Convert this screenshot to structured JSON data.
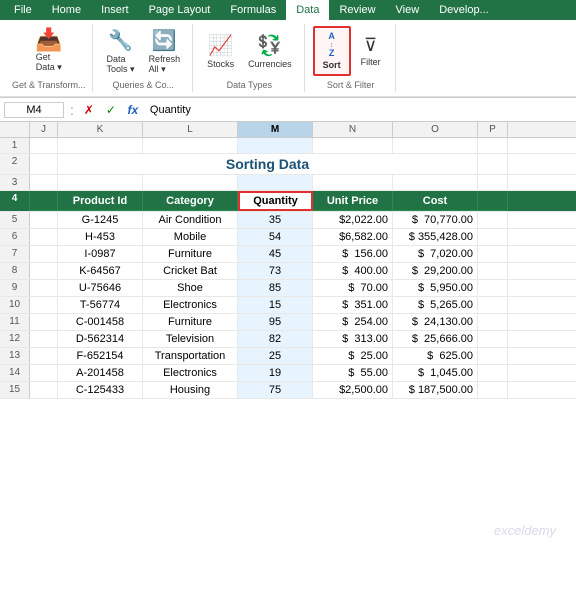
{
  "tabs": [
    "File",
    "Home",
    "Insert",
    "Page Layout",
    "Formulas",
    "Data",
    "Review",
    "View",
    "Develop..."
  ],
  "active_tab": "Data",
  "ribbon": {
    "groups": [
      {
        "label": "Get & Transform...",
        "buttons": [
          {
            "id": "get-data",
            "icon": "📥",
            "label": "Get\nData ▾"
          },
          {
            "id": "from-sheet",
            "icon": "📋",
            "label": ""
          },
          {
            "id": "recent",
            "icon": "🕐",
            "label": ""
          }
        ]
      },
      {
        "label": "Queries & Co...",
        "buttons": [
          {
            "id": "data-tools",
            "icon": "🔧",
            "label": "Data\nTools ▾"
          }
        ]
      },
      {
        "label": "Data Types",
        "buttons": [
          {
            "id": "stocks",
            "icon": "📈",
            "label": "Stocks"
          },
          {
            "id": "currencies",
            "icon": "💱",
            "label": "Currencies"
          }
        ]
      },
      {
        "label": "Sort & Filter",
        "buttons": [
          {
            "id": "refresh-all",
            "icon": "🔄",
            "label": "Refresh\nAll ▾"
          },
          {
            "id": "sort-az",
            "label": "Sort",
            "highlighted": true
          },
          {
            "id": "filter",
            "icon": "▽",
            "label": "Filter"
          }
        ]
      }
    ],
    "cell_ref": "M4",
    "formula": "Quantity"
  },
  "title": "Sorting Data",
  "columns": {
    "headers": [
      "J",
      "K",
      "L",
      "M",
      "N",
      "O",
      "P"
    ]
  },
  "rows": [
    {
      "row": 1,
      "cells": [
        "",
        "",
        "",
        "",
        "",
        "",
        ""
      ]
    },
    {
      "row": 2,
      "cells": [
        "",
        "",
        "",
        "Sorting Data",
        "",
        "",
        ""
      ],
      "type": "title"
    },
    {
      "row": 3,
      "cells": [
        "",
        "",
        "",
        "",
        "",
        "",
        ""
      ],
      "type": "empty"
    },
    {
      "row": 4,
      "cells": [
        "",
        "Product Id",
        "Category",
        "Quantity",
        "Unit Price",
        "Cost",
        ""
      ],
      "type": "header"
    },
    {
      "row": 5,
      "cells": [
        "",
        "G-1245",
        "Air Condition",
        "35",
        "$2,022.00",
        "$ 70,770.00",
        ""
      ]
    },
    {
      "row": 6,
      "cells": [
        "",
        "H-453",
        "Mobile",
        "54",
        "$6,582.00",
        "$ 355,428.00",
        ""
      ]
    },
    {
      "row": 7,
      "cells": [
        "",
        "I-0987",
        "Furniture",
        "45",
        "$  156.00",
        "$   7,020.00",
        ""
      ]
    },
    {
      "row": 8,
      "cells": [
        "",
        "K-64567",
        "Cricket Bat",
        "73",
        "$  400.00",
        "$  29,200.00",
        ""
      ]
    },
    {
      "row": 9,
      "cells": [
        "",
        "U-75646",
        "Shoe",
        "85",
        "$   70.00",
        "$   5,950.00",
        ""
      ]
    },
    {
      "row": 10,
      "cells": [
        "",
        "T-56774",
        "Electronics",
        "15",
        "$  351.00",
        "$   5,265.00",
        ""
      ]
    },
    {
      "row": 11,
      "cells": [
        "",
        "C-001458",
        "Furniture",
        "95",
        "$  254.00",
        "$  24,130.00",
        ""
      ]
    },
    {
      "row": 12,
      "cells": [
        "",
        "D-562314",
        "Television",
        "82",
        "$  313.00",
        "$  25,666.00",
        ""
      ]
    },
    {
      "row": 13,
      "cells": [
        "",
        "F-652154",
        "Transportation",
        "25",
        "$   25.00",
        "$     625.00",
        ""
      ]
    },
    {
      "row": 14,
      "cells": [
        "",
        "A-201458",
        "Electronics",
        "19",
        "$   55.00",
        "$   1,045.00",
        ""
      ]
    },
    {
      "row": 15,
      "cells": [
        "",
        "C-125433",
        "Housing",
        "75",
        "$2,500.00",
        "$ 187,500.00",
        ""
      ]
    }
  ]
}
